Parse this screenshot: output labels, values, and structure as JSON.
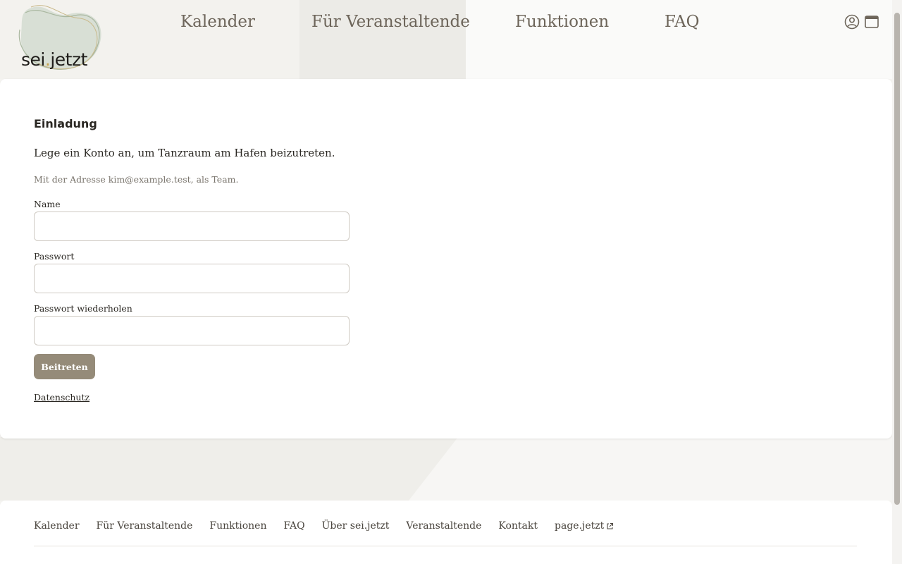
{
  "brand": {
    "logo_text_a": "sei",
    "logo_text_dot": ".",
    "logo_text_b": "jetzt"
  },
  "nav": {
    "items": [
      {
        "label": "Kalender"
      },
      {
        "label": "Für Veranstaltende"
      },
      {
        "label": "Funktionen"
      },
      {
        "label": "FAQ"
      }
    ]
  },
  "header_icons": [
    "user-circle-icon",
    "browser-window-icon"
  ],
  "invite": {
    "title": "Einladung",
    "intro": "Lege ein Konto an, um Tanzraum am Hafen beizutreten.",
    "note": "Mit der Adresse kim@example.test, als Team.",
    "fields": [
      {
        "label": "Name",
        "value": ""
      },
      {
        "label": "Passwort",
        "value": ""
      },
      {
        "label": "Passwort wiederholen",
        "value": ""
      }
    ],
    "submit_label": "Beitreten",
    "privacy_label": "Datenschutz"
  },
  "footer": {
    "items": [
      {
        "label": "Kalender"
      },
      {
        "label": "Für Veranstaltende"
      },
      {
        "label": "Funktionen"
      },
      {
        "label": "FAQ"
      },
      {
        "label": "Über sei.jetzt"
      },
      {
        "label": "Veranstaltende"
      },
      {
        "label": "Kontakt"
      },
      {
        "label": "page.jetzt",
        "icon": "external-link-icon"
      }
    ]
  },
  "colors": {
    "accent": "#958b79",
    "nav_text": "#6d655a",
    "logo_blob": "#cfd8cc",
    "logo_dot": "#c9a24a"
  }
}
